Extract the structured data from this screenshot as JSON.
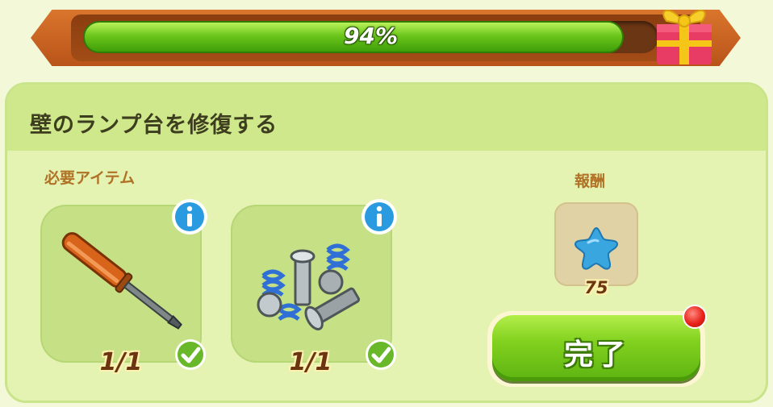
{
  "progress": {
    "value": 0.94,
    "label": "94%"
  },
  "task": {
    "title": "壁のランプ台を修復する"
  },
  "required_items": {
    "label": "必要アイテム",
    "items": [
      {
        "icon": "screwdriver-icon",
        "count_label": "1/1",
        "completed": true
      },
      {
        "icon": "screws-springs-icon",
        "count_label": "1/1",
        "completed": true
      }
    ]
  },
  "reward": {
    "label": "報酬",
    "icon": "blue-star-icon",
    "amount": "75"
  },
  "complete_button": {
    "label": "完了",
    "has_notification": true
  },
  "colors": {
    "progress_fill": "#6cc61b",
    "banner": "#c6611f",
    "panel": "#e4f3b2",
    "label_brown": "#b07226"
  }
}
